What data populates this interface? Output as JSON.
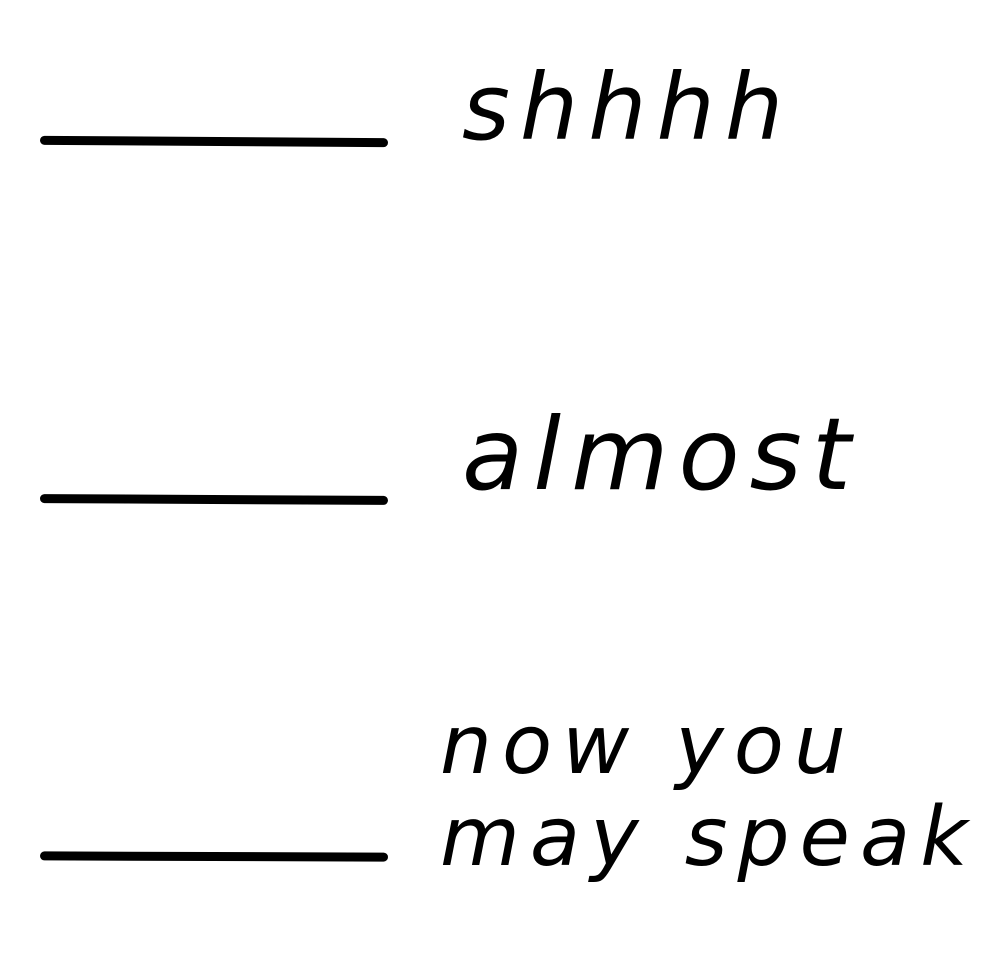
{
  "levels": [
    {
      "label": "shhhh"
    },
    {
      "label": "almost"
    },
    {
      "label_line1": "now you",
      "label_line2": "may speak"
    }
  ],
  "colors": {
    "ink": "#000000",
    "background": "#ffffff"
  }
}
